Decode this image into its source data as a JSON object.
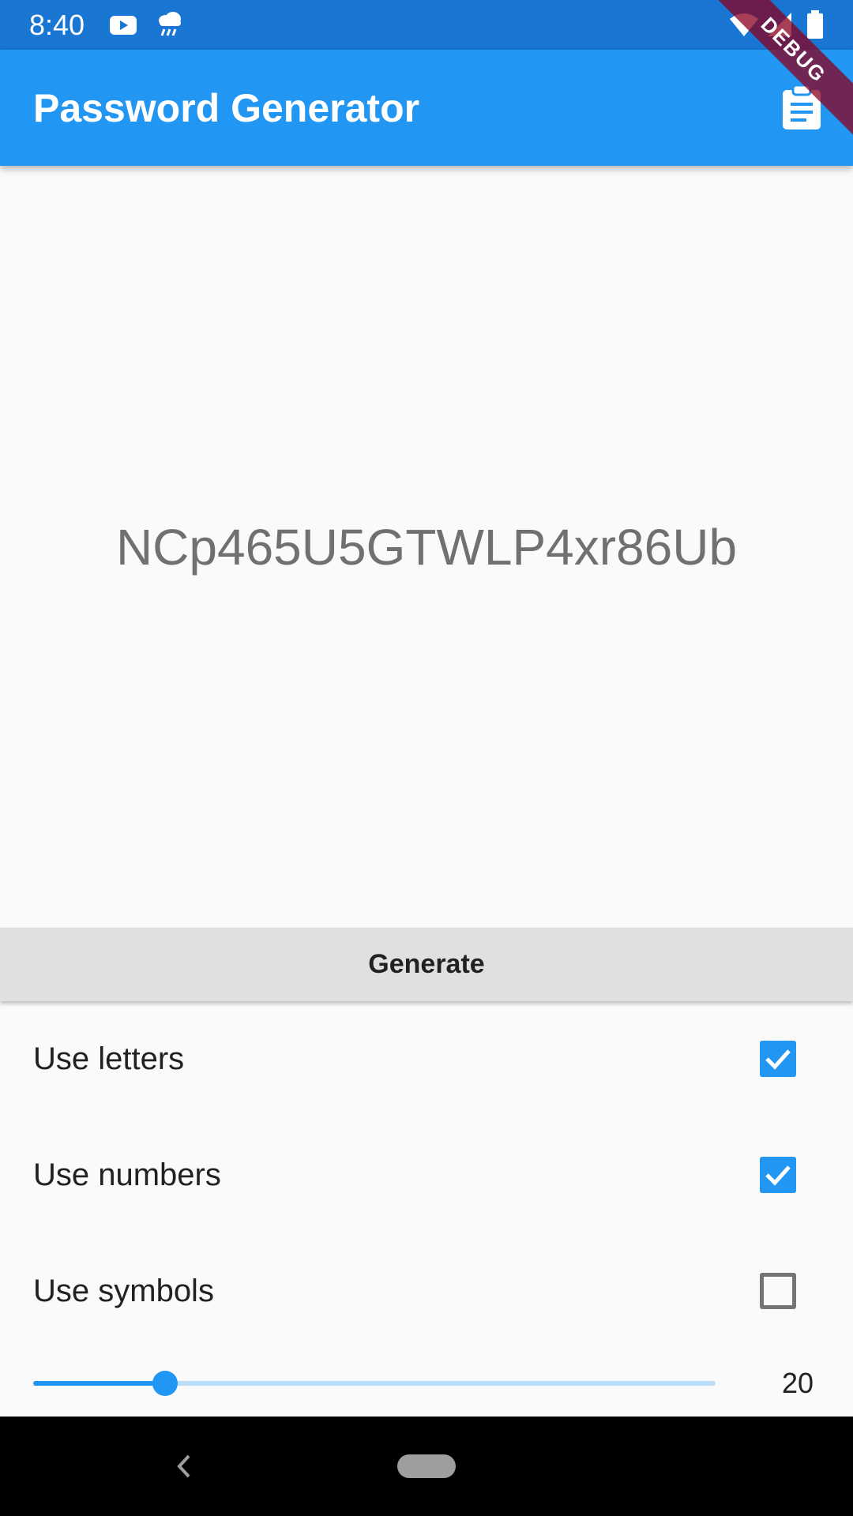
{
  "status_bar": {
    "time": "8:40",
    "icons": [
      "youtube-icon",
      "rain-cloud-icon",
      "wifi-icon",
      "cell-signal-icon",
      "battery-icon"
    ]
  },
  "app_bar": {
    "title": "Password Generator",
    "action_icon": "clipboard-icon",
    "debug_banner": "DEBUG"
  },
  "main": {
    "password": "NCp465U5GTWLP4xr86Ub"
  },
  "generate_button": {
    "label": "Generate"
  },
  "options": [
    {
      "label": "Use letters",
      "checked": true
    },
    {
      "label": "Use numbers",
      "checked": true
    },
    {
      "label": "Use symbols",
      "checked": false
    }
  ],
  "length_slider": {
    "value": "20",
    "fraction": 0.193
  },
  "colors": {
    "primary": "#2196f3",
    "primary_dark": "#1976d2",
    "track_inactive": "#bbdefb",
    "button_bg": "#e0e0e0"
  }
}
